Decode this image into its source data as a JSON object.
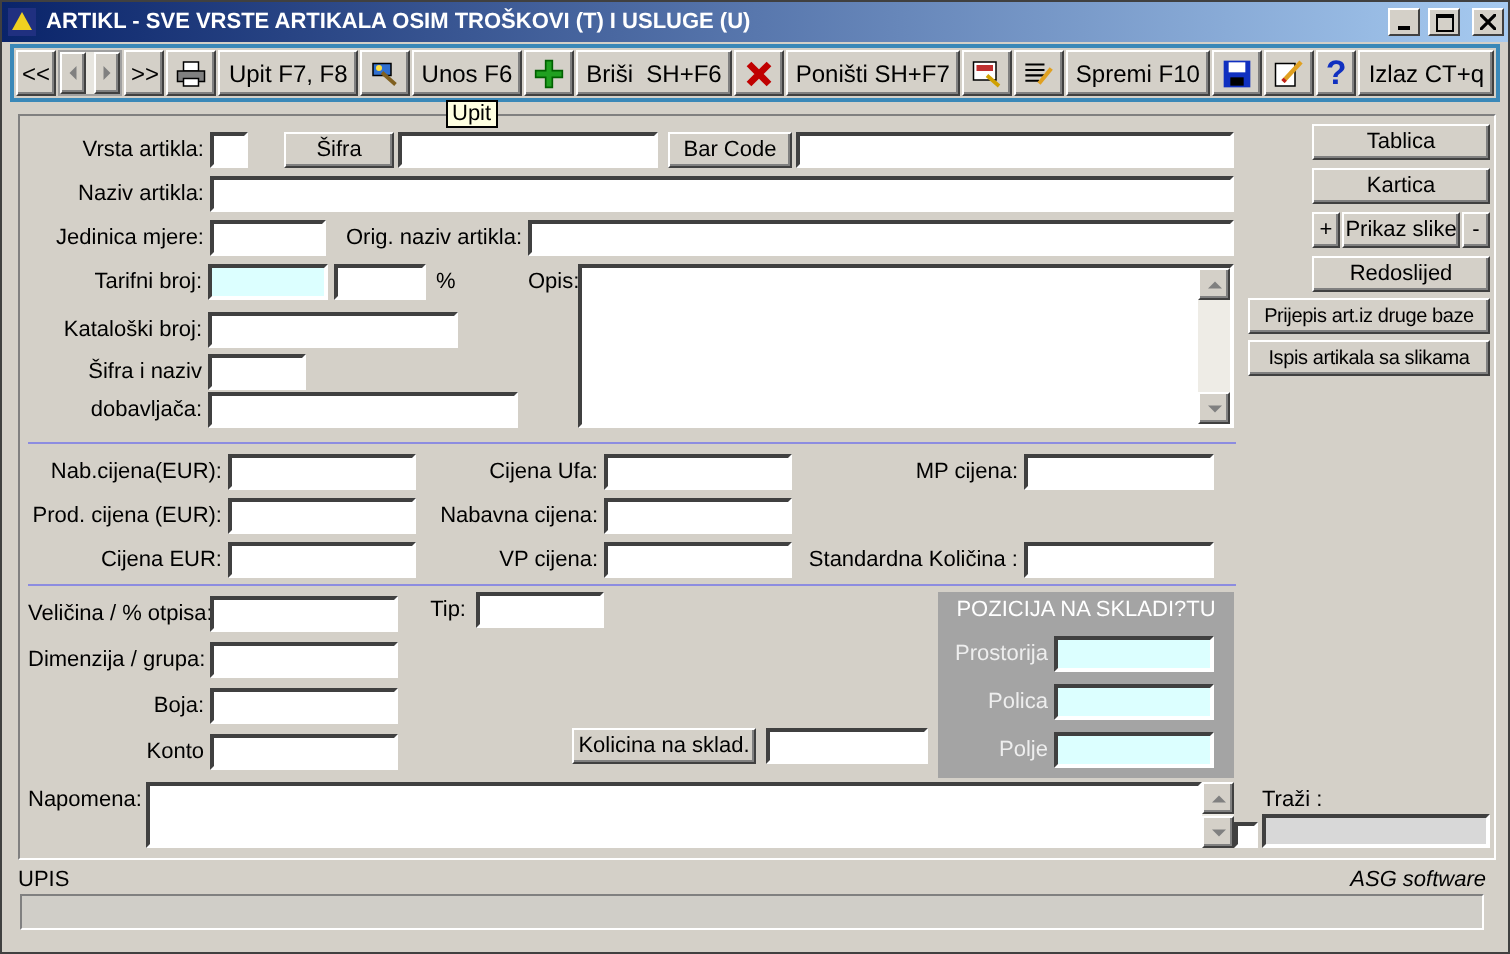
{
  "window": {
    "title": "ARTIKL - SVE VRSTE ARTIKALA OSIM TROŠKOVI (T) I USLUGE (U)"
  },
  "toolbar": [
    {
      "kind": "nav",
      "label": "<<"
    },
    {
      "kind": "scroller"
    },
    {
      "kind": "nav",
      "label": ">>"
    },
    {
      "kind": "icon"
    },
    {
      "kind": "text",
      "label": "Upit F7, F8"
    },
    {
      "kind": "icon"
    },
    {
      "kind": "text",
      "label": "Unos F6"
    },
    {
      "kind": "icon"
    },
    {
      "kind": "text",
      "label": "Briši  SH+F6"
    },
    {
      "kind": "icon"
    },
    {
      "kind": "text",
      "label": "Poništi SH+F7"
    },
    {
      "kind": "icon"
    },
    {
      "kind": "icon"
    },
    {
      "kind": "text",
      "label": "Spremi F10"
    },
    {
      "kind": "icon"
    },
    {
      "kind": "icon"
    },
    {
      "kind": "glyph",
      "label": "?"
    },
    {
      "kind": "text",
      "label": "Izlaz CT+q"
    }
  ],
  "tooltip": "Upit",
  "main": {
    "article_type": {
      "label": "Vrsta artikla:"
    },
    "code_button": "Šifra",
    "barcode_button": "Bar Code",
    "name": {
      "label": "Naziv artikla:"
    },
    "unit": {
      "label": "Jedinica mjere:"
    },
    "orig_name": {
      "label": "Orig. naziv artikla:"
    },
    "tariff": {
      "label": "Tarifni broj:",
      "highlighted": true
    },
    "percent": "%",
    "description": {
      "label": "Opis:"
    },
    "catalog": {
      "label": "Kataloški broj:"
    },
    "supplier": {
      "label_1": "Šifra i naziv",
      "label_2": "dobavljača:"
    }
  },
  "prices": {
    "columns": [
      [
        {
          "label": "Nab.cijena(EUR):"
        },
        {
          "label": "Prod. cijena (EUR):"
        },
        {
          "label": "Cijena EUR:"
        }
      ],
      [
        {
          "label": "Cijena Ufa:"
        },
        {
          "label": "Nabavna cijena:"
        },
        {
          "label": "VP cijena:"
        }
      ],
      [
        {
          "label": "MP cijena:"
        },
        {
          "label": "Standardna Količina :"
        }
      ]
    ]
  },
  "details": {
    "fields": [
      {
        "label": "Veličina / % otpisa:"
      },
      {
        "label": "Dimenzija / grupa:"
      },
      {
        "label": "Boja:"
      },
      {
        "label": "Konto"
      }
    ],
    "type_field": {
      "label": "Tip:"
    },
    "stock_button": "Kolicina na sklad.",
    "location": {
      "title": "POZICIJA NA SKLADI?TU",
      "fields": [
        {
          "label": "Prostorija",
          "highlighted": true
        },
        {
          "label": "Polica",
          "highlighted": true
        },
        {
          "label": "Polje",
          "highlighted": true
        }
      ]
    },
    "note": {
      "label": "Napomena:"
    }
  },
  "side_buttons": [
    {
      "kind": "wide",
      "label": "Tablica"
    },
    {
      "kind": "wide",
      "label": "Kartica"
    },
    {
      "kind": "zoom",
      "minus": "-",
      "plus": "+",
      "label": "Prikaz slike"
    },
    {
      "kind": "wide",
      "label": "Redoslijed"
    },
    {
      "kind": "full",
      "label": "Prijepis art.iz druge baze"
    },
    {
      "kind": "full",
      "label": "Ispis artikala sa slikama"
    }
  ],
  "search": {
    "label": "Traži :",
    "checked": false,
    "disabled": true
  },
  "status": {
    "mode": "UPIS",
    "brand": "ASG software"
  }
}
